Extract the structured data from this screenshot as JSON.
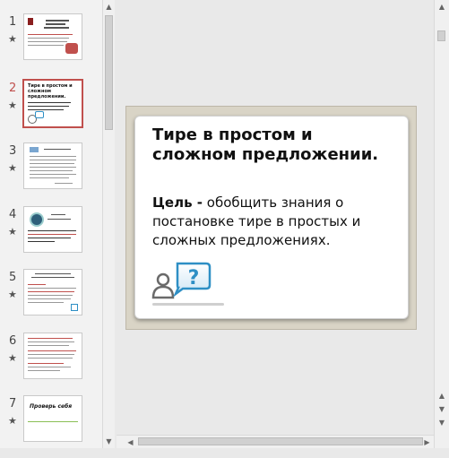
{
  "thumbnails": [
    {
      "number": "1",
      "star": "★"
    },
    {
      "number": "2",
      "star": "★"
    },
    {
      "number": "3",
      "star": "★"
    },
    {
      "number": "4",
      "star": "★"
    },
    {
      "number": "5",
      "star": "★"
    },
    {
      "number": "6",
      "star": "★"
    },
    {
      "number": "7",
      "star": "★"
    }
  ],
  "thumb_text": {
    "slide2_title": "Тире в простом и сложном предложении.",
    "slide7_title": "Проверь себя"
  },
  "slide": {
    "title": "Тире в простом и сложном предложении.",
    "goal_label": "Цель -",
    "goal_text": " обобщить знания о постановке тире в простых и сложных предложениях."
  },
  "selected_index": 2,
  "colors": {
    "selection": "#c0504d",
    "bubble": "#2e8fc5",
    "slide_frame": "#d9d4c6"
  },
  "icons": {
    "scroll_up": "▲",
    "scroll_down": "▼",
    "scroll_left": "◀",
    "scroll_right": "▶"
  }
}
